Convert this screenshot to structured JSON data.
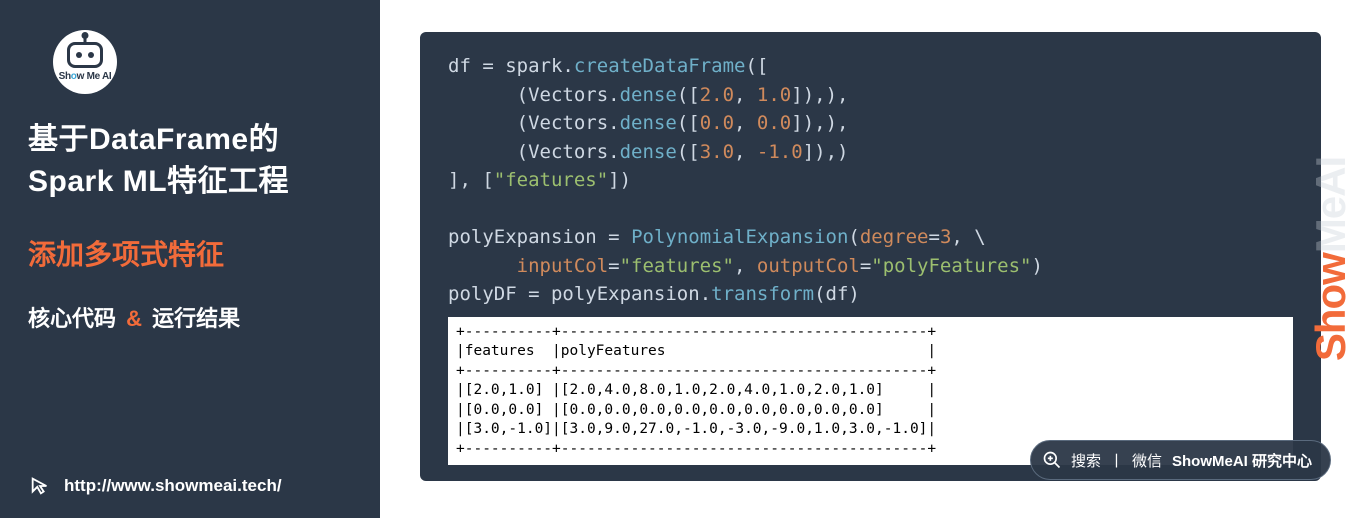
{
  "sidebar": {
    "logo_label": "ShowMeAI",
    "title_line1": "基于DataFrame的",
    "title_line2": "Spark ML特征工程",
    "subtitle": "添加多项式特征",
    "desc_left": "核心代码",
    "desc_amp": "&",
    "desc_right": "运行结果",
    "url": "http://www.showmeai.tech/"
  },
  "code": {
    "l1_a": "df ",
    "l1_b": "=",
    "l1_c": " spark",
    "l1_d": ".",
    "l1_e": "createDataFrame",
    "l1_f": "([",
    "l2_a": "      (Vectors",
    "l2_b": ".",
    "l2_c": "dense",
    "l2_d": "([",
    "l2_n1": "2.0",
    "l2_cm": ", ",
    "l2_n2": "1.0",
    "l2_e": "]),),",
    "l3_a": "      (Vectors",
    "l3_b": ".",
    "l3_c": "dense",
    "l3_d": "([",
    "l3_n1": "0.0",
    "l3_cm": ", ",
    "l3_n2": "0.0",
    "l3_e": "]),),",
    "l4_a": "      (Vectors",
    "l4_b": ".",
    "l4_c": "dense",
    "l4_d": "([",
    "l4_n1": "3.0",
    "l4_cm": ", ",
    "l4_n2": "-1.0",
    "l4_e": "]),)",
    "l5_a": "], [",
    "l5_s": "\"features\"",
    "l5_b": "])",
    "l7_a": "polyExpansion ",
    "l7_b": "=",
    "l7_c": " ",
    "l7_d": "PolynomialExpansion",
    "l7_e": "(",
    "l7_f": "degree",
    "l7_g": "=",
    "l7_h": "3",
    "l7_i": ", \\",
    "l8_a": "      ",
    "l8_b": "inputCol",
    "l8_c": "=",
    "l8_d": "\"features\"",
    "l8_e": ", ",
    "l8_f": "outputCol",
    "l8_g": "=",
    "l8_h": "\"polyFeatures\"",
    "l8_i": ")",
    "l9_a": "polyDF ",
    "l9_b": "=",
    "l9_c": " polyExpansion",
    "l9_d": ".",
    "l9_e": "transform",
    "l9_f": "(df)"
  },
  "output": "+----------+------------------------------------------+\n|features  |polyFeatures                              |\n+----------+------------------------------------------+\n|[2.0,1.0] |[2.0,4.0,8.0,1.0,2.0,4.0,1.0,2.0,1.0]     |\n|[0.0,0.0] |[0.0,0.0,0.0,0.0,0.0,0.0,0.0,0.0,0.0]     |\n|[3.0,-1.0]|[3.0,9.0,27.0,-1.0,-3.0,-9.0,1.0,3.0,-1.0]|\n+----------+------------------------------------------+",
  "watermark": {
    "part1": "Show",
    "part2": "MeAI"
  },
  "search_pill": {
    "label1": "搜索",
    "sep": "丨",
    "label2": "微信",
    "strong": "ShowMeAI 研究中心"
  }
}
